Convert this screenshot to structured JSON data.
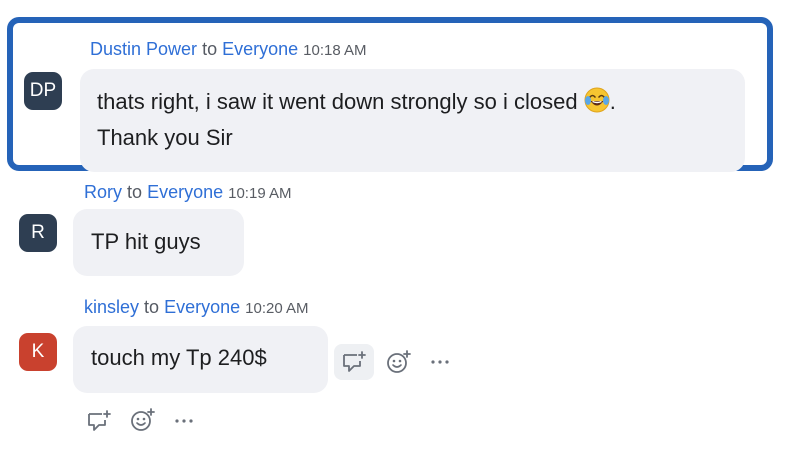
{
  "colors": {
    "highlight_border": "#2563b8",
    "link": "#2f6fd6",
    "bubble_bg": "#f0f1f5",
    "avatar_dark": "#2e3e52",
    "avatar_red": "#c9412e"
  },
  "messages": [
    {
      "initials": "DP",
      "sender": "Dustin Power",
      "to_word": "to",
      "recipient": "Everyone",
      "time": "10:18 AM",
      "line1": "thats right, i saw it went down strongly so i closed",
      "line1_end": ".",
      "emoji": "face-with-tears-of-joy-emoji",
      "line2": "Thank you Sir"
    },
    {
      "initials": "R",
      "sender": "Rory",
      "to_word": "to",
      "recipient": "Everyone",
      "time": "10:19 AM",
      "text": "TP hit guys"
    },
    {
      "initials": "K",
      "sender": "kinsley",
      "to_word": "to",
      "recipient": "Everyone",
      "time": "10:20 AM",
      "text": "touch my Tp 240$"
    }
  ],
  "actions": {
    "reply_icon": "reply-icon",
    "reaction_icon": "add-reaction-icon",
    "more_icon": "more-options-icon"
  }
}
